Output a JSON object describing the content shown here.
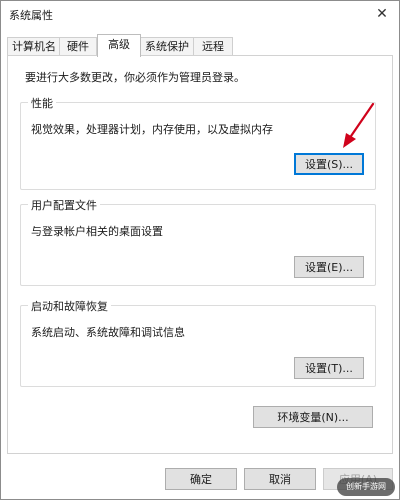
{
  "window": {
    "title": "系统属性",
    "close_glyph": "✕"
  },
  "tabs": [
    "计算机名",
    "硬件",
    "高级",
    "系统保护",
    "远程"
  ],
  "active_tab": "高级",
  "admin_note": "要进行大多数更改，你必须作为管理员登录。",
  "performance": {
    "title": "性能",
    "description": "视觉效果，处理器计划，内存使用，以及虚拟内存",
    "button": "设置(S)..."
  },
  "user_profiles": {
    "title": "用户配置文件",
    "description": "与登录帐户相关的桌面设置",
    "button": "设置(E)..."
  },
  "startup_recovery": {
    "title": "启动和故障恢复",
    "description": "系统启动、系统故障和调试信息",
    "button": "设置(T)..."
  },
  "env_button": "环境变量(N)...",
  "footer": {
    "ok": "确定",
    "cancel": "取消",
    "apply": "应用(A)"
  },
  "watermark": "创新手游网",
  "colors": {
    "arrow": "#d0021b",
    "focus_border": "#0078d7",
    "button_bg": "#e1e1e1"
  },
  "icons": {
    "close": "close-icon",
    "arrow": "red-arrow-annotation"
  }
}
